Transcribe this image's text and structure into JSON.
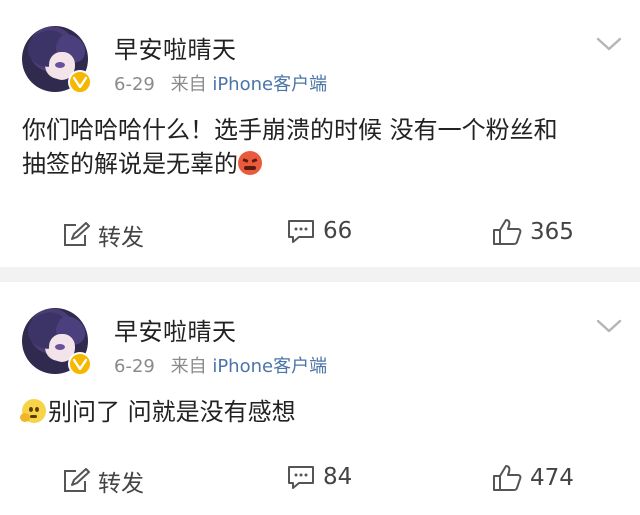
{
  "posts": [
    {
      "username": "早安啦晴天",
      "date": "6-29",
      "source_prefix": "来自",
      "source": "iPhone客户端",
      "text_line1": "你们哈哈哈什么！选手崩溃的时候 没有一个粉丝和",
      "text_line2": "抽签的解说是无辜的",
      "emoji": "angry-face-emoji",
      "repost_label": "转发",
      "comment_count": "66",
      "like_count": "365"
    },
    {
      "username": "早安啦晴天",
      "date": "6-29",
      "source_prefix": "来自",
      "source": "iPhone客户端",
      "emoji": "thinking-face-emoji",
      "text_line1": "别问了 问就是没有感想",
      "repost_label": "转发",
      "comment_count": "84",
      "like_count": "474"
    }
  ],
  "colors": {
    "source_link": "#4b74a8",
    "meta_gray": "#8a8a8a",
    "badge": "#f6b700",
    "separator": "#f2f2f2"
  }
}
